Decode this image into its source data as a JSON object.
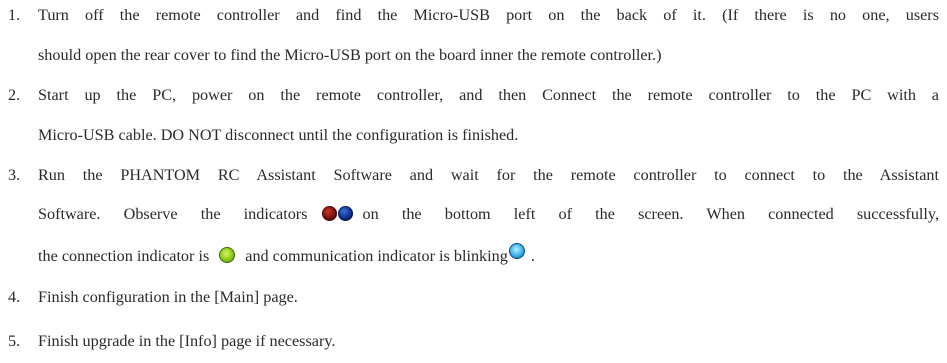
{
  "steps": [
    {
      "number": "1.",
      "line1": "Turn off the remote controller and find the Micro-USB port on the back of it. (If there is no one, users",
      "line2": "should open the rear cover to find the Micro-USB port on the board inner the remote controller.)"
    },
    {
      "number": "2.",
      "line1": "Start up the PC, power on the remote controller, and then Connect the remote controller to the PC with a",
      "line2": "Micro-USB cable. DO NOT disconnect until the configuration is finished."
    },
    {
      "number": "3.",
      "line1": "Run the PHANTOM RC Assistant Software and wait for the remote controller to connect to the Assistant",
      "line2a": "Software. Observe the indicators",
      "line2b": "on the bottom left of the screen. When connected successfully,",
      "line3a": "the connection indicator is",
      "line3b": "and communication indicator is blinking",
      "line3c": "."
    },
    {
      "number": "4.",
      "line1": "Finish configuration in the [Main] page."
    },
    {
      "number": "5.",
      "line1": "Finish upgrade in the [Info] page if necessary."
    }
  ],
  "icons": {
    "indicator_pair": [
      "red-indicator-icon",
      "blue-indicator-icon"
    ],
    "connection_indicator": "green-indicator-icon",
    "communication_indicator": "cyan-indicator-icon"
  }
}
